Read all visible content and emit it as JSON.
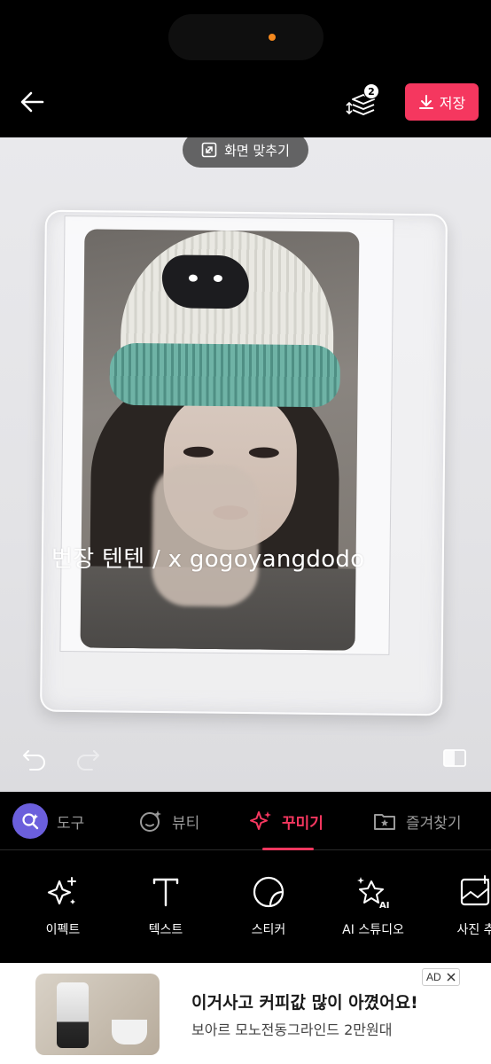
{
  "header": {
    "save_label": "저장",
    "layers_count": "2"
  },
  "canvas": {
    "fit_screen_label": "화면 맞추기",
    "watermark_text": "번장 텐텐 / x gogoyangdodo"
  },
  "tabs": [
    {
      "label": "도구",
      "icon": "tool-search-icon",
      "active": false
    },
    {
      "label": "뷰티",
      "icon": "beauty-face-icon",
      "active": false
    },
    {
      "label": "꾸미기",
      "icon": "sparkle-icon",
      "active": true
    },
    {
      "label": "즐겨찾기",
      "icon": "favorites-folder-icon",
      "active": false
    }
  ],
  "tools": [
    {
      "label": "이펙트",
      "icon": "effect-sparkle-icon"
    },
    {
      "label": "텍스트",
      "icon": "text-icon"
    },
    {
      "label": "스티커",
      "icon": "sticker-icon"
    },
    {
      "label": "AI 스튜디오",
      "icon": "ai-studio-icon"
    },
    {
      "label": "사진 추",
      "icon": "add-photo-icon"
    }
  ],
  "ad": {
    "badge": "AD",
    "title": "이거사고 커피값 많이 아꼈어요!",
    "subtitle": "보아르 모노전동그라인드 2만원대"
  },
  "colors": {
    "accent": "#f5375f",
    "tool_circle": "#6b5fdc",
    "status_dot": "#f5891e"
  }
}
